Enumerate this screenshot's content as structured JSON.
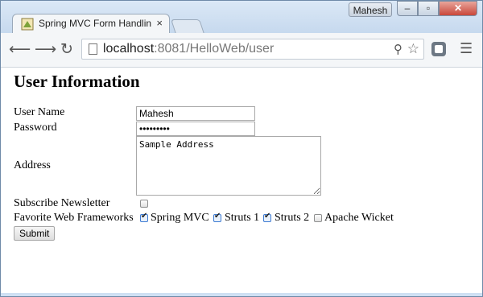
{
  "browser": {
    "tab_title": "Spring MVC Form Handlin",
    "tab_close": "×",
    "user_badge": "Mahesh",
    "window_buttons": {
      "minimize": "–",
      "maximize": "▫",
      "close": "✕"
    },
    "url_host": "localhost",
    "url_rest": ":8081/HelloWeb/user",
    "icons": [
      "back-icon",
      "forward-icon",
      "reload-icon",
      "page-icon",
      "zoom-icon",
      "star-icon",
      "extension-icon",
      "menu-icon"
    ]
  },
  "page": {
    "heading": "User Information",
    "fields": {
      "username_label": "User Name",
      "username_value": "Mahesh",
      "password_label": "Password",
      "password_value": "•••••••••",
      "address_label": "Address",
      "address_value": "Sample Address",
      "newsletter_label": "Subscribe Newsletter",
      "newsletter_checked": false,
      "frameworks_label": "Favorite Web Frameworks",
      "frameworks": [
        {
          "label": "Spring MVC",
          "checked": true
        },
        {
          "label": "Struts 1",
          "checked": true
        },
        {
          "label": "Struts 2",
          "checked": true
        },
        {
          "label": "Apache Wicket",
          "checked": false
        }
      ]
    },
    "submit_label": "Submit"
  }
}
